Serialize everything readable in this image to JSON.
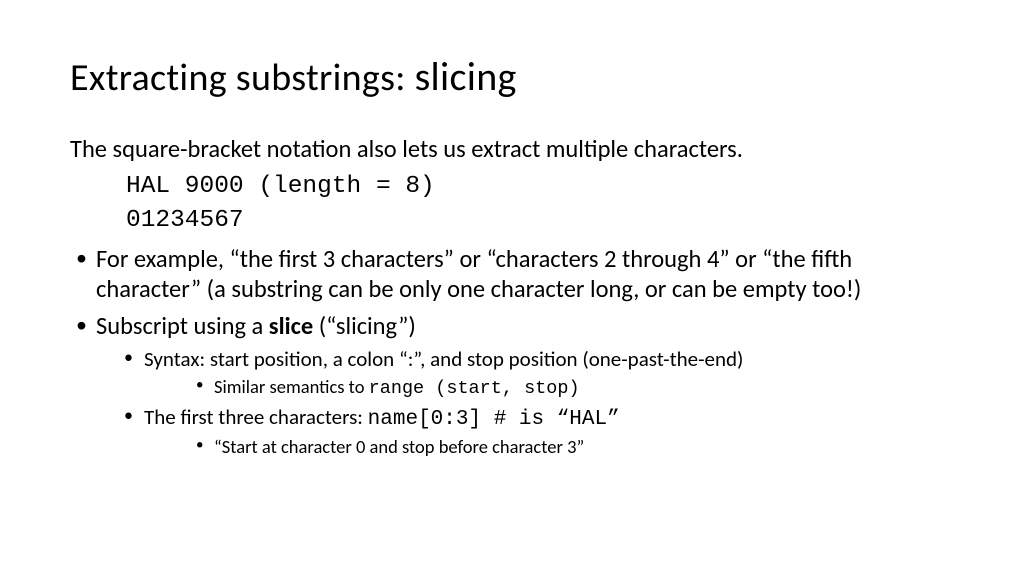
{
  "title": {
    "prefix": "Extracting substrings:  ",
    "emphasis": "slicing"
  },
  "intro": "The square-bracket notation also lets us extract multiple characters.",
  "code": {
    "line1": "HAL 9000 (length = 8)",
    "line2": "01234567"
  },
  "bullets": {
    "b1": "For example, “the first 3 characters” or “characters 2 through 4” or “the fifth character” (a substring can be only one character long, or can be empty too!)",
    "b2_pre": "Subscript using a ",
    "b2_bold": "slice",
    "b2_post": " (“slicing”)",
    "b2_1": "Syntax: start position, a colon “:”, and stop position (one-past-the-end)",
    "b2_1_1_pre": "Similar semantics to ",
    "b2_1_1_code": "range (start, stop)",
    "b2_2_pre": "The first three characters: ",
    "b2_2_code": "name[0:3]    # is “HAL”",
    "b2_2_1": "“Start at character 0 and stop before character 3”"
  }
}
